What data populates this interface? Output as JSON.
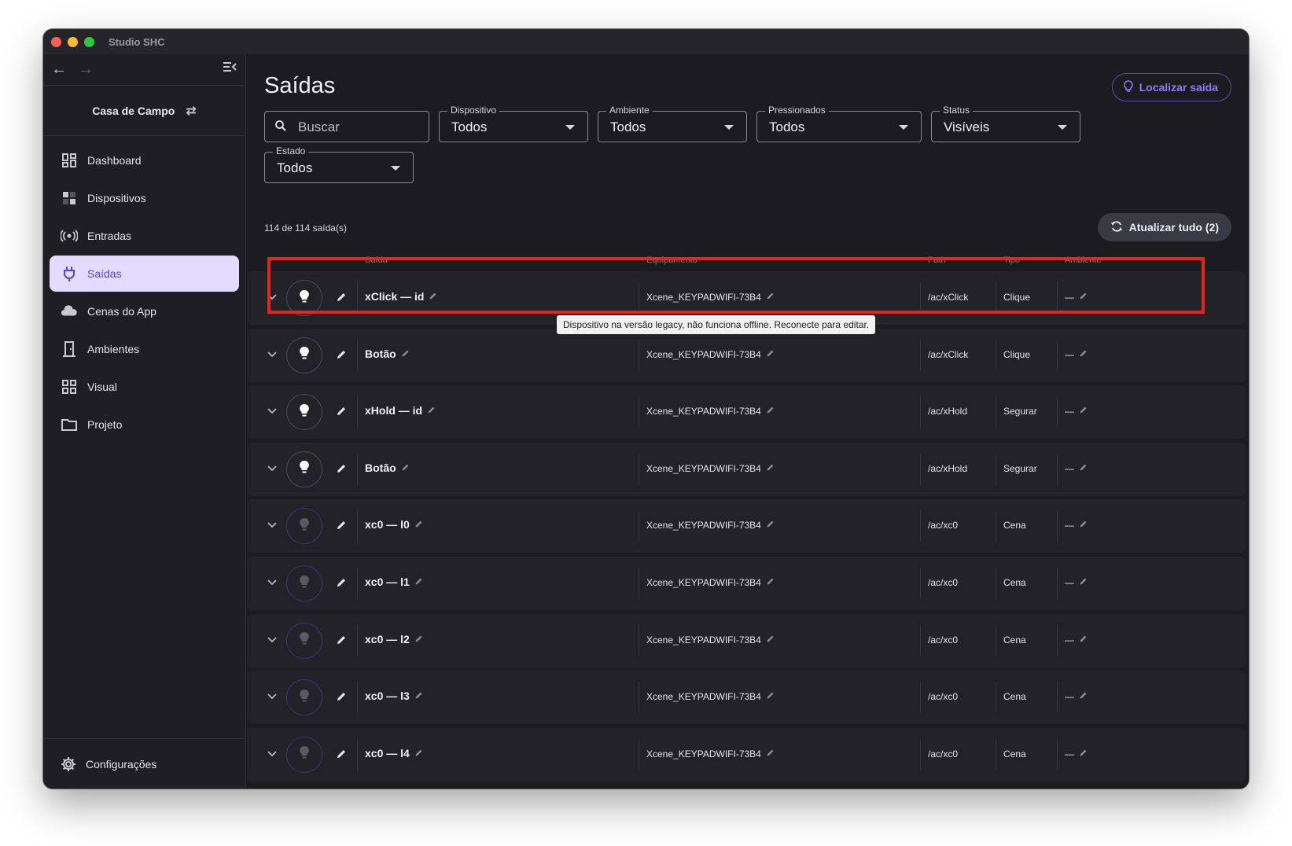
{
  "window": {
    "title": "Studio SHC"
  },
  "sidebar": {
    "project": "Casa de Campo",
    "items": [
      {
        "label": "Dashboard",
        "icon": "dashboard-icon"
      },
      {
        "label": "Dispositivos",
        "icon": "devices-icon"
      },
      {
        "label": "Entradas",
        "icon": "broadcast-icon"
      },
      {
        "label": "Saídas",
        "icon": "plug-icon",
        "active": true
      },
      {
        "label": "Cenas do App",
        "icon": "cloud-icon"
      },
      {
        "label": "Ambientes",
        "icon": "door-icon"
      },
      {
        "label": "Visual",
        "icon": "grid-icon"
      },
      {
        "label": "Projeto",
        "icon": "folder-icon"
      }
    ],
    "settings_label": "Configurações"
  },
  "page": {
    "title": "Saídas",
    "locate_label": "Localizar saída",
    "search_placeholder": "Buscar",
    "filters": {
      "dispositivo": {
        "label": "Dispositivo",
        "value": "Todos"
      },
      "ambiente": {
        "label": "Ambiente",
        "value": "Todos"
      },
      "pressionados": {
        "label": "Pressionados",
        "value": "Todos"
      },
      "status": {
        "label": "Status",
        "value": "Visíveis"
      },
      "estado": {
        "label": "Estado",
        "value": "Todos"
      }
    },
    "count_text": "114 de 114 saída(s)",
    "refresh_label": "Atualizar tudo (2)",
    "columns": {
      "saida": "Saída",
      "equipamento": "Equipamento",
      "path": "Path",
      "tipo": "Tipo",
      "ambiente": "Ambiente"
    },
    "tooltip": "Dispositivo na versão legacy, não funciona offline. Reconecte para editar."
  },
  "rows": [
    {
      "name": "xClick — id",
      "device": "Xcene_KEYPADWIFI-73B4",
      "path": "/ac/xClick",
      "type": "Clique",
      "room": "—",
      "bulb_on": true
    },
    {
      "name": "Botão",
      "device": "Xcene_KEYPADWIFI-73B4",
      "path": "/ac/xClick",
      "type": "Clique",
      "room": "—",
      "bulb_on": true
    },
    {
      "name": "xHold — id",
      "device": "Xcene_KEYPADWIFI-73B4",
      "path": "/ac/xHold",
      "type": "Segurar",
      "room": "—",
      "bulb_on": true
    },
    {
      "name": "Botão",
      "device": "Xcene_KEYPADWIFI-73B4",
      "path": "/ac/xHold",
      "type": "Segurar",
      "room": "—",
      "bulb_on": true
    },
    {
      "name": "xc0 — l0",
      "device": "Xcene_KEYPADWIFI-73B4",
      "path": "/ac/xc0",
      "type": "Cena",
      "room": "—",
      "bulb_on": false
    },
    {
      "name": "xc0 — l1",
      "device": "Xcene_KEYPADWIFI-73B4",
      "path": "/ac/xc0",
      "type": "Cena",
      "room": "—",
      "bulb_on": false
    },
    {
      "name": "xc0 — l2",
      "device": "Xcene_KEYPADWIFI-73B4",
      "path": "/ac/xc0",
      "type": "Cena",
      "room": "—",
      "bulb_on": false
    },
    {
      "name": "xc0 — l3",
      "device": "Xcene_KEYPADWIFI-73B4",
      "path": "/ac/xc0",
      "type": "Cena",
      "room": "—",
      "bulb_on": false
    },
    {
      "name": "xc0 — l4",
      "device": "Xcene_KEYPADWIFI-73B4",
      "path": "/ac/xc0",
      "type": "Cena",
      "room": "—",
      "bulb_on": false
    }
  ],
  "colors": {
    "accent": "#8f7dff",
    "active_bg": "#e4dcff",
    "highlight": "#e3251b"
  }
}
